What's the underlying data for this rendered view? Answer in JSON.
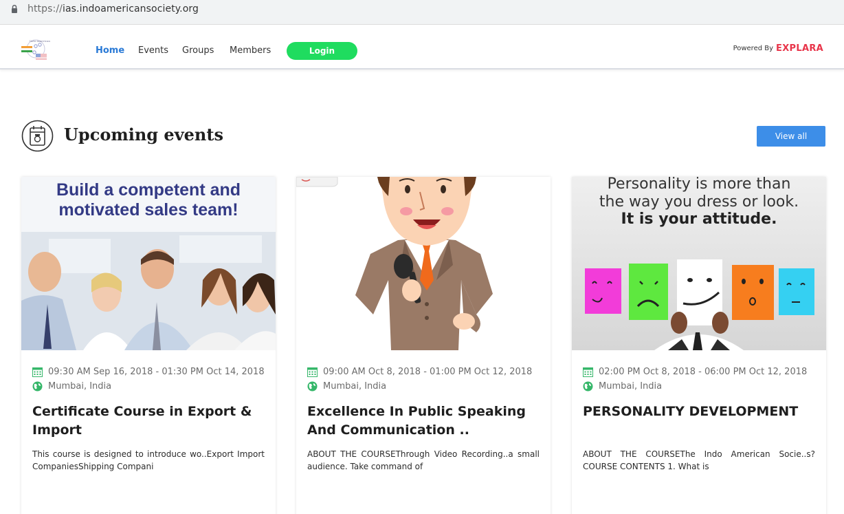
{
  "browser": {
    "url_protocol": "https://",
    "url_host": "ias.indoamericansociety.org"
  },
  "nav": {
    "items": [
      {
        "label": "Home"
      },
      {
        "label": "Events"
      },
      {
        "label": "Groups"
      },
      {
        "label": "Members"
      }
    ],
    "login_label": "Login",
    "powered_by": "Powered By",
    "brand": "EXPLARA",
    "logo_icon": "indo-american-society-logo"
  },
  "section": {
    "title": "Upcoming events",
    "view_all_label": "View all",
    "icon": "calendar-camera-icon"
  },
  "events": [
    {
      "image_headline_1": "Build a competent and",
      "image_headline_2": "motivated sales team!",
      "datetime": "09:30 AM Sep 16, 2018 - 01:30 PM Oct 14, 2018",
      "location": "Mumbai, India",
      "title": "Certificate Course in Export & Import",
      "description": "This course is designed to introduce wo..Export Import CompaniesShipping Compani"
    },
    {
      "datetime": "09:00 AM Oct 8, 2018 - 01:00 PM Oct 12, 2018",
      "location": "Mumbai, India",
      "title": "Excellence In Public Speaking And Communication ..",
      "description": "ABOUT THE COURSEThrough Video Recording..a small audience. Take command of"
    },
    {
      "image_quote_1": "Personality is more than",
      "image_quote_2": "the way you dress or look.",
      "image_quote_3": "It is your attitude.",
      "datetime": "02:00 PM Oct 8, 2018 - 06:00 PM Oct 12, 2018",
      "location": "Mumbai, India",
      "title": "PERSONALITY DEVELOPMENT",
      "description": "ABOUT THE COURSEThe Indo American Socie..s? COURSE CONTENTS 1. What is"
    }
  ],
  "colors": {
    "accent": "#2a7ad6",
    "login_green": "#1fdc5f",
    "view_all_blue": "#3d8ee8",
    "icon_green": "#36b76a",
    "brand_red": "#e8354a"
  }
}
